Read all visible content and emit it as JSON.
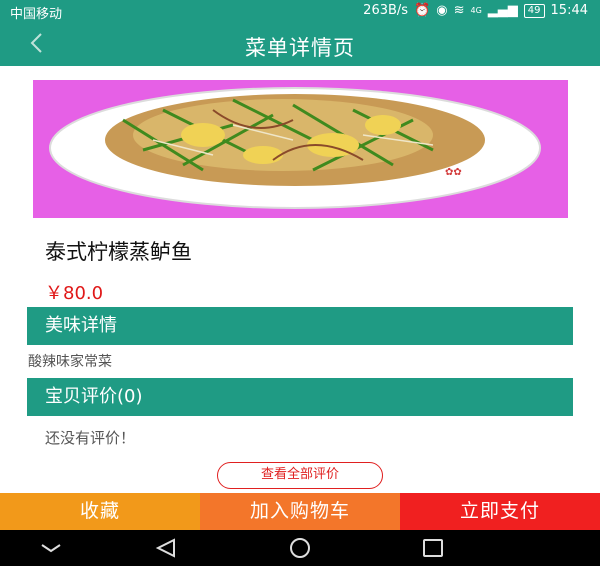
{
  "status": {
    "carrier": "中国移动",
    "speed": "263B/s",
    "battery": "49",
    "time": "15:44",
    "network": "4G"
  },
  "header": {
    "title": "菜单详情页"
  },
  "dish": {
    "name": "泰式柠檬蒸鲈鱼",
    "price": "￥80.0"
  },
  "sections": {
    "taste_title": "美味详情",
    "taste_desc": "酸辣味家常菜",
    "review_title": "宝贝评价(0)",
    "review_empty": "还没有评价！",
    "view_all": "查看全部评价"
  },
  "actions": {
    "favorite": "收藏",
    "add_cart": "加入购物车",
    "pay_now": "立即支付"
  },
  "colors": {
    "primary": "#1f9b84",
    "price": "#e01818",
    "favorite": "#f2991a",
    "cart": "#f3762a",
    "pay": "#f02020"
  }
}
